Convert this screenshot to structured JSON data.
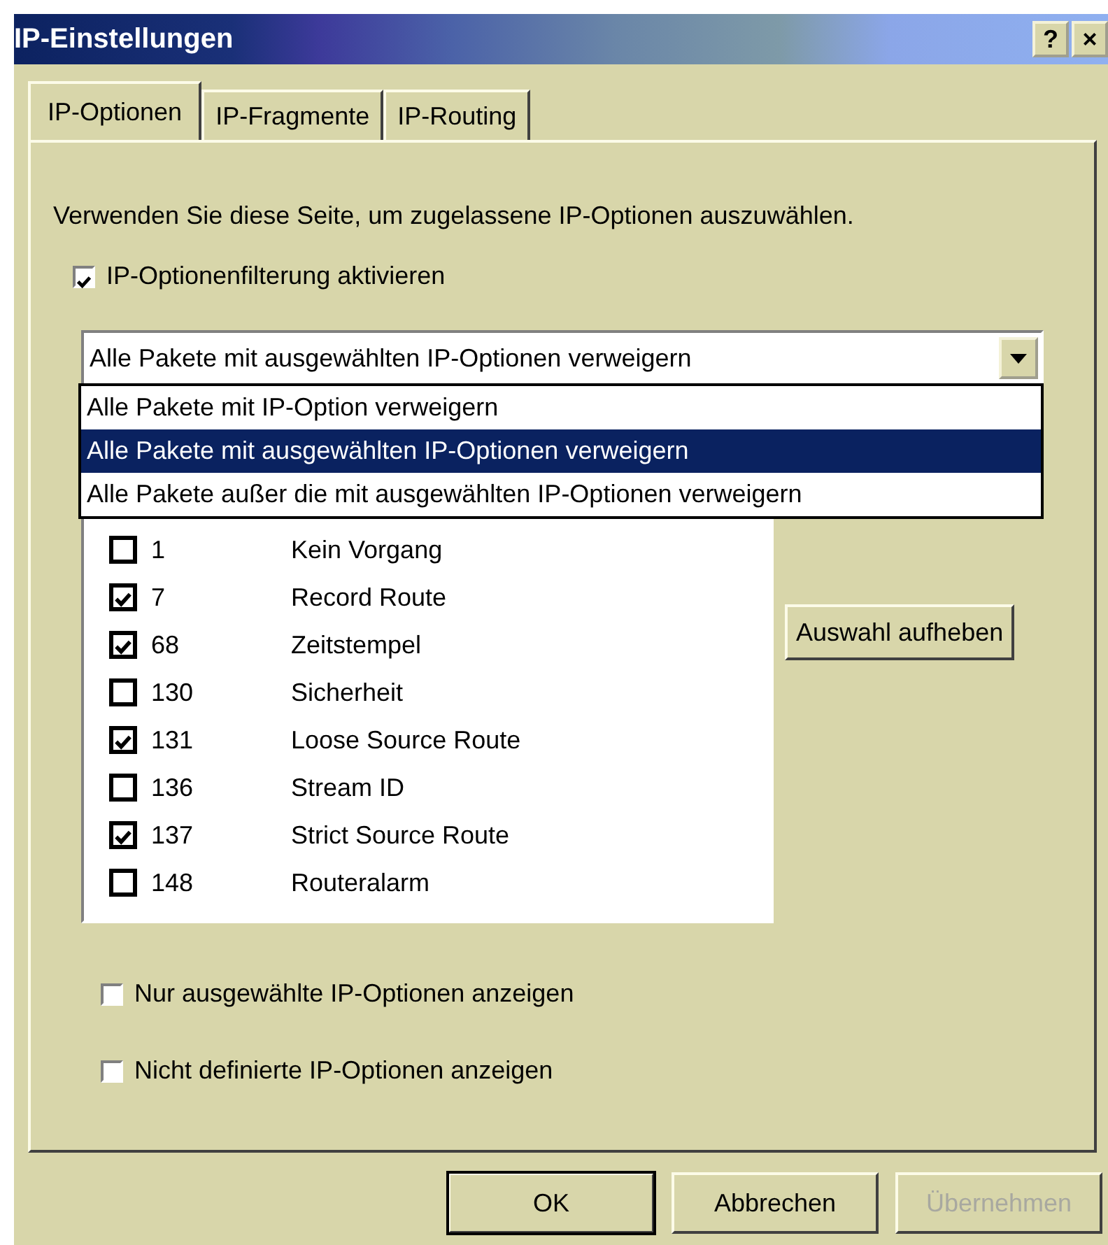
{
  "window": {
    "title": "IP-Einstellungen",
    "help_button": "?",
    "close_button": "×"
  },
  "tabs": [
    {
      "label": "IP-Optionen",
      "selected": true
    },
    {
      "label": "IP-Fragmente",
      "selected": false
    },
    {
      "label": "IP-Routing",
      "selected": false
    }
  ],
  "description": "Verwenden Sie diese Seite, um zugelassene IP-Optionen auszuwählen.",
  "filter_checkbox": {
    "label": "IP-Optionenfilterung aktivieren",
    "checked": true
  },
  "dropdown": {
    "value": "Alle Pakete mit ausgewählten IP-Optionen verweigern",
    "expanded": true,
    "options": [
      {
        "label": "Alle Pakete mit IP-Option verweigern",
        "selected": false
      },
      {
        "label": "Alle Pakete mit ausgewählten IP-Optionen verweigern",
        "selected": true
      },
      {
        "label": "Alle Pakete außer die mit ausgewählten IP-Optionen verweigern",
        "selected": false
      }
    ]
  },
  "ip_options": [
    {
      "number": "1",
      "name": "Kein Vorgang",
      "checked": false
    },
    {
      "number": "7",
      "name": "Record Route",
      "checked": true
    },
    {
      "number": "68",
      "name": "Zeitstempel",
      "checked": true
    },
    {
      "number": "130",
      "name": "Sicherheit",
      "checked": false
    },
    {
      "number": "131",
      "name": "Loose Source Route",
      "checked": true
    },
    {
      "number": "136",
      "name": "Stream ID",
      "checked": false
    },
    {
      "number": "137",
      "name": "Strict Source Route",
      "checked": true
    },
    {
      "number": "148",
      "name": "Routeralarm",
      "checked": false
    }
  ],
  "clear_selection_button": "Auswahl aufheben",
  "view_checkboxes": [
    {
      "label": "Nur ausgewählte IP-Optionen anzeigen",
      "checked": false
    },
    {
      "label": "Nicht definierte IP-Optionen anzeigen",
      "checked": false
    }
  ],
  "buttons": [
    {
      "label": "OK",
      "default": true,
      "disabled": false
    },
    {
      "label": "Abbrechen",
      "default": false,
      "disabled": false
    },
    {
      "label": "Übernehmen",
      "default": false,
      "disabled": true
    }
  ]
}
